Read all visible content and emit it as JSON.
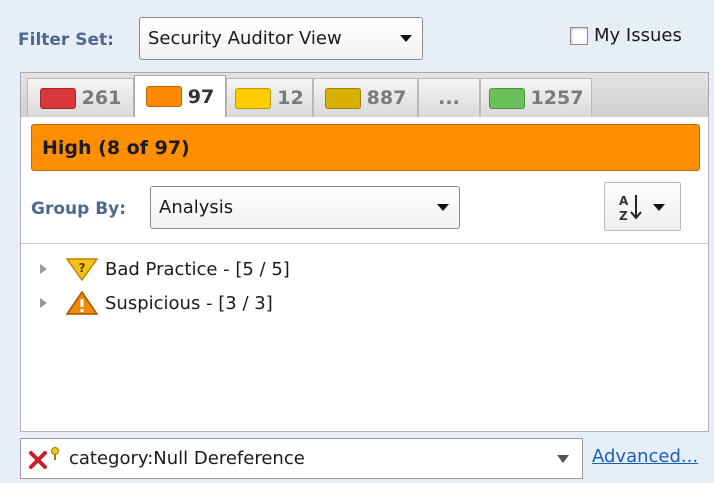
{
  "filter": {
    "label": "Filter Set:",
    "value": "Security Auditor View"
  },
  "my_issues": {
    "label": "My Issues",
    "checked": false
  },
  "tabs": [
    {
      "count": "261",
      "color": "#d9383a"
    },
    {
      "count": "97",
      "color": "#ff8a00",
      "active": true
    },
    {
      "count": "12",
      "color": "#ffcc00"
    },
    {
      "count": "887",
      "color": "#d8b100"
    },
    {
      "count": "..."
    },
    {
      "count": "1257",
      "color": "#6cc05a"
    }
  ],
  "banner": {
    "text": "High (8 of 97)",
    "color": "#ff8f00"
  },
  "group_by": {
    "label": "Group By:",
    "value": "Analysis"
  },
  "tree": [
    {
      "label": "Bad Practice - [5 / 5]",
      "icon": "bad-practice-icon"
    },
    {
      "label": "Suspicious - [3 / 3]",
      "icon": "warning-icon"
    }
  ],
  "search": {
    "value": "category:Null Dereference"
  },
  "advanced_link": "Advanced..."
}
